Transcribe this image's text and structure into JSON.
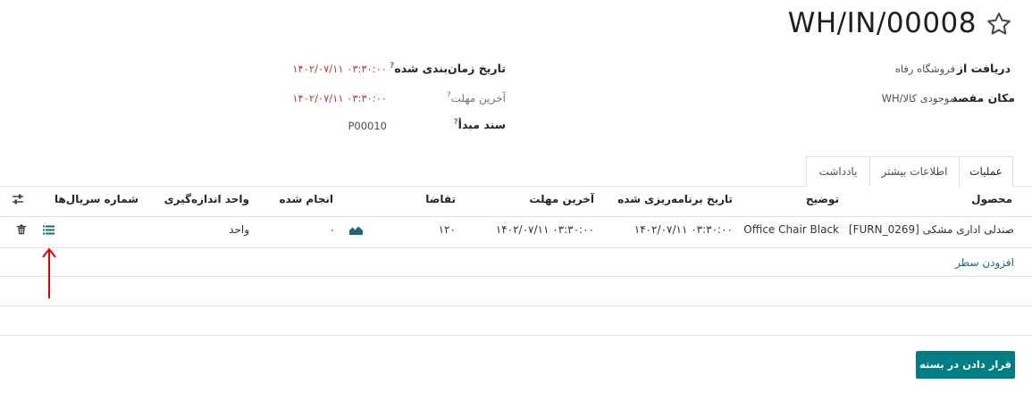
{
  "header": {
    "title": "WH/IN/00008",
    "favorite_icon": "star-icon"
  },
  "fields": {
    "receive_from_label": "دریافت از",
    "receive_from_value": "فروشگاه رفاه",
    "destination_label": "مکان مقصد",
    "destination_value": "WH/موجودی کالا",
    "scheduled_label": "تاریخ زمان‌بندی شده",
    "scheduled_value": "۱۴۰۲/۰۷/۱۱ ۰۳:۳۰:۰۰",
    "deadline_label": "آخرین مهلت",
    "deadline_value": "۱۴۰۲/۰۷/۱۱ ۰۳:۳۰:۰۰",
    "source_label": "سند مبدأ",
    "source_value": "P00010",
    "help_mark": "?"
  },
  "tabs": [
    "عملیات",
    "اطلاعات بیشتر",
    "یادداشت"
  ],
  "table": {
    "headers": {
      "product": "محصول",
      "description": "توضیح",
      "scheduled": "تاریخ برنامه‌ریزی شده",
      "deadline": "آخرین مهلت",
      "demand": "تقاضا",
      "done": "انجام شده",
      "uom": "واحد اندازه‌گیری",
      "serials": "شماره سریال‌ها"
    },
    "row": {
      "product": "[FURN_0269] صندلی اداری مشکی",
      "description": "Office Chair Black",
      "scheduled": "۱۴۰۲/۰۷/۱۱ ۰۳:۳۰:۰۰",
      "deadline": "۱۴۰۲/۰۷/۱۱ ۰۳:۳۰:۰۰",
      "demand": "۱۲۰",
      "done": "۰",
      "uom": "واحد"
    },
    "add_line": "افزودن سطر"
  },
  "actions": {
    "put_in_pack": "قرار دادن در بسته"
  },
  "colors": {
    "accent": "#017e84",
    "link": "#1a6b73",
    "date_red": "#b53a3a",
    "annotation_arrow": "#e00000"
  }
}
